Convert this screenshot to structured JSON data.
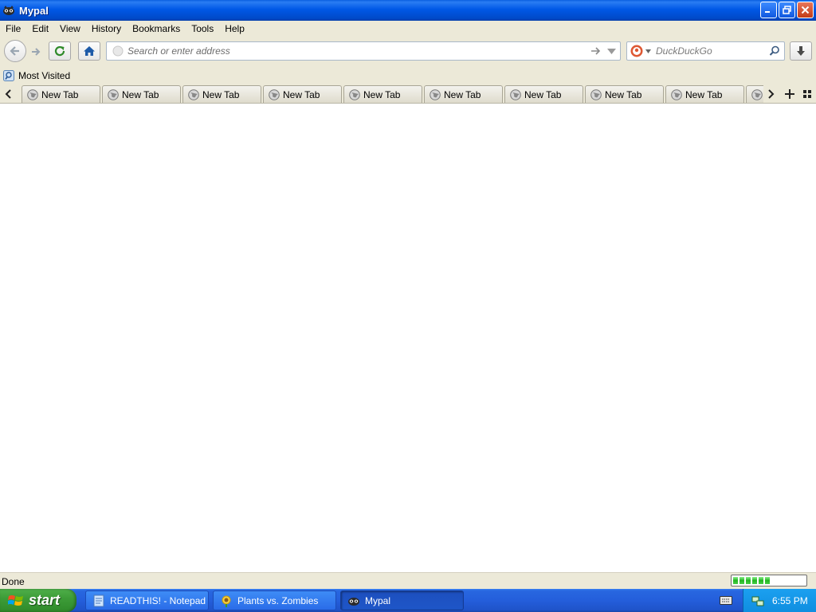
{
  "window": {
    "title": "Mypal"
  },
  "menu": {
    "items": [
      "File",
      "Edit",
      "View",
      "History",
      "Bookmarks",
      "Tools",
      "Help"
    ]
  },
  "navbar": {
    "url_placeholder": "Search or enter address",
    "url_value": "",
    "search_placeholder": "DuckDuckGo",
    "search_engine_icon": "duckduckgo-icon"
  },
  "bookmarks": {
    "items": [
      {
        "label": "Most Visited",
        "icon": "most-visited-icon"
      }
    ]
  },
  "tabs": {
    "items": [
      {
        "label": "New Tab"
      },
      {
        "label": "New Tab"
      },
      {
        "label": "New Tab"
      },
      {
        "label": "New Tab"
      },
      {
        "label": "New Tab"
      },
      {
        "label": "New Tab"
      },
      {
        "label": "New Tab"
      },
      {
        "label": "New Tab"
      },
      {
        "label": "New Tab"
      },
      {
        "label": ""
      }
    ]
  },
  "statusbar": {
    "text": "Done",
    "progress_fraction": 0.5,
    "progress_blocks_filled": 6
  },
  "taskbar": {
    "start_label": "start",
    "tasks": [
      {
        "label": "READTHIS! - Notepad",
        "icon": "notepad-icon",
        "active": false
      },
      {
        "label": "Plants vs. Zombies",
        "icon": "plants-vs-zombies-icon",
        "active": false
      },
      {
        "label": "Mypal",
        "icon": "mypal-icon",
        "active": true
      }
    ],
    "clock": "6:55 PM"
  },
  "colors": {
    "titlebar": "#0058e6",
    "chrome": "#ece9d8",
    "taskbar": "#245edb",
    "start_button": "#3d9c38",
    "tray": "#0f8ee0"
  }
}
